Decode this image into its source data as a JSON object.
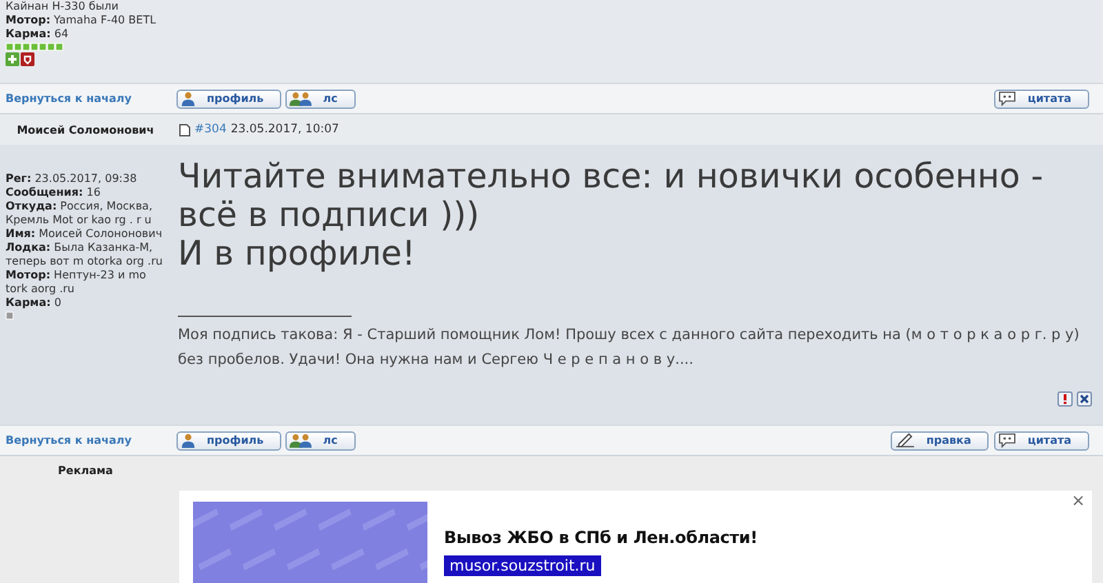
{
  "top_post": {
    "profile": [
      "Кайнан Н-330 были",
      "**Мотор:** Yamaha F-40 BETL",
      "**Карма:** 64"
    ]
  },
  "nav_rows": [
    {
      "back_link": "Вернуться к началу",
      "buttons": [
        {
          "kind": "profile",
          "label": "профиль"
        },
        {
          "kind": "pm",
          "label": "лс"
        }
      ],
      "right_buttons": [
        {
          "kind": "quote",
          "label": "цитата"
        }
      ]
    },
    {
      "back_link": "Вернуться к началу",
      "buttons": [
        {
          "kind": "profile",
          "label": "профиль"
        },
        {
          "kind": "pm",
          "label": "лс"
        }
      ],
      "right_buttons": [
        {
          "kind": "edit",
          "label": "правка"
        },
        {
          "kind": "quote",
          "label": "цитата"
        }
      ]
    }
  ],
  "post": {
    "author": "Моисей Соломонович",
    "number": "#304",
    "date": "23.05.2017, 10:07",
    "profile": [
      "**Рег:** 23.05.2017, 09:38",
      "**Сообщения:** 16",
      "**Откуда:** Россия, Москва, Кремль Mot or kao rg . r u",
      "**Имя:** Моисей Солононович",
      "**Лодка:** Была Казанка-М, теперь вот m otorka org .ru",
      "**Мотор:** Нептун-23 и mo tork aorg .ru",
      "**Карма:** 0"
    ],
    "body": [
      "Читайте внимательно все: и новички особенно - всё в подписи )))",
      "И в профиле!"
    ],
    "signature": "Моя подпись такова: Я - Старший помощник Лом! Прошу всех с данного сайта переходить на (м о т о р к а о р г. р у) без пробелов. Удачи! Она нужна нам и Сергею Ч е р е п а н о в у...."
  },
  "ad": {
    "label": "Реклама",
    "title": "Вывоз ЖБО в СПб и Лен.области!",
    "url": "musor.souzstroit.ru",
    "close": "×"
  }
}
